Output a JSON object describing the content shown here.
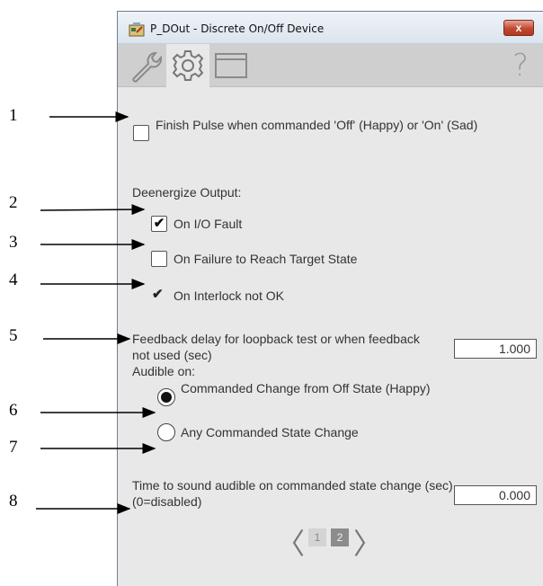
{
  "window": {
    "title": "P_DOut - Discrete On/Off Device",
    "close_label": "x"
  },
  "toolbar": {
    "tabs": [
      {
        "icon": "wrench-icon",
        "active": false
      },
      {
        "icon": "gear-icon",
        "active": true
      },
      {
        "icon": "window-icon",
        "active": false
      }
    ],
    "help_label": "?"
  },
  "callouts": [
    "1",
    "2",
    "3",
    "4",
    "5",
    "6",
    "7",
    "8"
  ],
  "config": {
    "finish_pulse": {
      "label": "Finish Pulse when commanded 'Off' (Happy) or 'On' (Sad)",
      "checked": false
    },
    "deenergize_heading": "Deenergize Output:",
    "on_io_fault": {
      "label": "On I/O Fault",
      "checked": true
    },
    "on_failure_target": {
      "label": "On Failure to Reach Target State",
      "checked": false
    },
    "on_interlock": {
      "label": "On Interlock not OK",
      "checked": true
    },
    "feedback_delay": {
      "label": "Feedback delay for loopback test or when feedback not used (sec)",
      "value": "1.000"
    },
    "audible_heading": "Audible on:",
    "audible_options": [
      {
        "label": "Commanded Change from Off State (Happy)",
        "selected": true
      },
      {
        "label": "Any Commanded State Change",
        "selected": false
      }
    ],
    "audible_time": {
      "label": "Time to sound audible on commanded state change (sec) (0=disabled)",
      "value": "0.000"
    }
  },
  "pager": {
    "pages": [
      "1",
      "2"
    ],
    "current": "2",
    "prev_label": "〈",
    "next_label": "〉"
  },
  "colors": {
    "close_red": "#c2482f",
    "page_active": "#8c8c8c",
    "page_inactive": "#d4d4d4"
  }
}
